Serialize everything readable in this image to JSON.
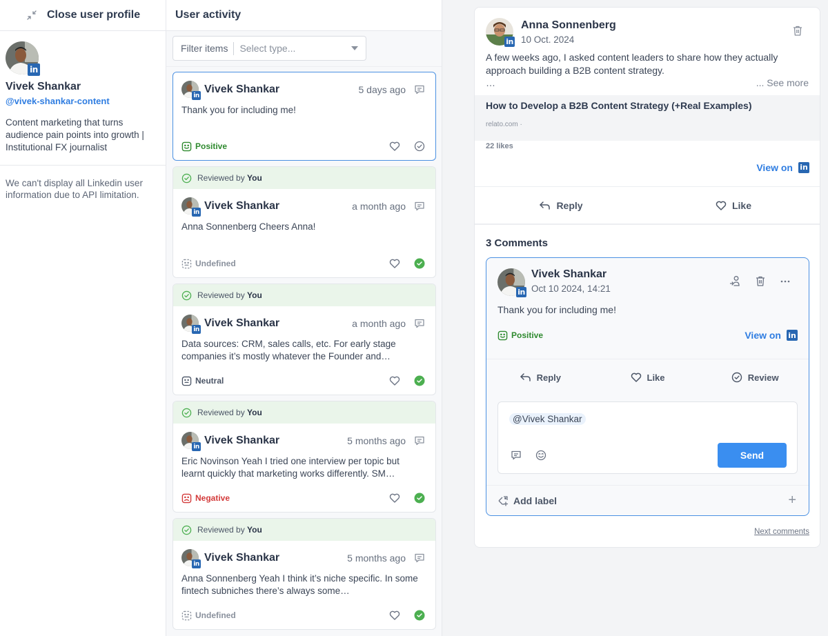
{
  "sidebar": {
    "close_label": "Close user profile",
    "profile": {
      "name": "Vivek Shankar",
      "handle": "@vivek-shankar-content",
      "bio": "Content marketing that turns audience pain points into growth | Institutional FX journalist"
    },
    "api_note": "We can't display all Linkedin user information due to API limitation."
  },
  "activity": {
    "title": "User activity",
    "filter": {
      "label": "Filter items",
      "placeholder": "Select type..."
    },
    "items": [
      {
        "reviewed": false,
        "name": "Vivek Shankar",
        "time": "5 days ago",
        "text": "Thank you for including me!",
        "sentiment": "Positive"
      },
      {
        "reviewed": true,
        "reviewed_prefix": "Reviewed by",
        "reviewer": "You",
        "name": "Vivek Shankar",
        "time": "a month ago",
        "text": "Anna Sonnenberg Cheers Anna!",
        "sentiment": "Undefined"
      },
      {
        "reviewed": true,
        "reviewed_prefix": "Reviewed by",
        "reviewer": "You",
        "name": "Vivek Shankar",
        "time": "a month ago",
        "text": "Data sources: CRM, sales calls, etc. For early stage companies it’s mostly whatever the Founder and…",
        "sentiment": "Neutral"
      },
      {
        "reviewed": true,
        "reviewed_prefix": "Reviewed by",
        "reviewer": "You",
        "name": "Vivek Shankar",
        "time": "5 months ago",
        "text": "Eric Novinson Yeah I tried one interview per topic but learnt quickly that marketing works differently. SM…",
        "sentiment": "Negative"
      },
      {
        "reviewed": true,
        "reviewed_prefix": "Reviewed by",
        "reviewer": "You",
        "name": "Vivek Shankar",
        "time": "5 months ago",
        "text": "Anna Sonnenberg Yeah I think it’s niche specific. In some fintech subniches there’s always some…",
        "sentiment": "Undefined"
      }
    ]
  },
  "post": {
    "author": "Anna Sonnenberg",
    "date": "10 Oct. 2024",
    "text": "A few weeks ago, I asked content leaders to share how they actually approach building a B2B content strategy.",
    "ellipsis": "…",
    "see_more": "... See more",
    "link_title": "How to Develop a B2B Content Strategy (+Real Examples)",
    "link_domain": "relato.com ·",
    "likes": "22 likes",
    "view_on": "View on",
    "actions": {
      "reply": "Reply",
      "like": "Like"
    }
  },
  "comments": {
    "title": "3 Comments",
    "comment": {
      "author": "Vivek Shankar",
      "date": "Oct 10 2024, 14:21",
      "text": "Thank you for including me!",
      "sentiment": "Positive",
      "view_on": "View on",
      "actions": {
        "reply": "Reply",
        "like": "Like",
        "review": "Review"
      },
      "compose": {
        "mention": "@Vivek Shankar",
        "send": "Send"
      },
      "add_label": "Add label",
      "add_symbol": "+"
    },
    "next": "Next comments"
  },
  "colors": {
    "accent": "#3a8ef0",
    "link": "#2f7de1",
    "linkedin": "#2867b2",
    "positive": "#2f8a2f",
    "negative": "#d33a3a",
    "reviewed_bg": "#eaf5ea",
    "check_green": "#4caf50"
  }
}
